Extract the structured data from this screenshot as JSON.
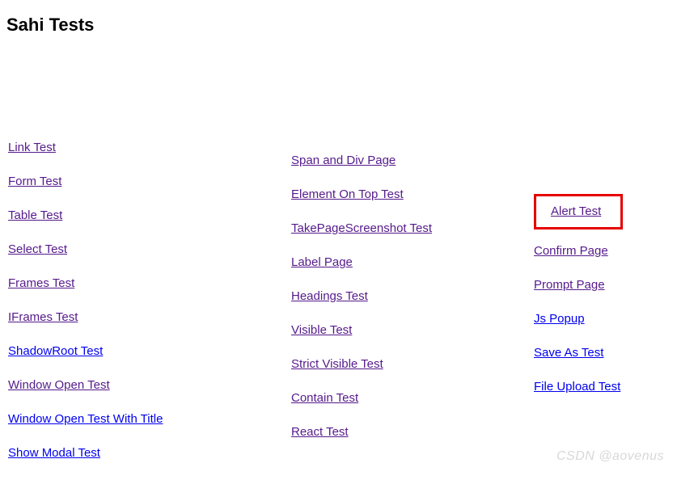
{
  "title": "Sahi Tests",
  "col1": [
    "Link Test",
    "Form Test",
    "Table Test",
    "Select Test",
    "Frames Test",
    "IFrames Test",
    "ShadowRoot Test",
    "Window Open Test",
    "Window Open Test With Title",
    "Show Modal Test"
  ],
  "col2": [
    "Span and Div Page",
    "Element On Top Test",
    "TakePageScreenshot Test",
    "Label Page",
    "Headings Test",
    "Visible Test",
    "Strict Visible Test",
    "Contain Test",
    "React Test"
  ],
  "col3": [
    "Alert Test",
    "Confirm Page",
    "Prompt Page",
    "Js Popup",
    "Save As Test",
    "File Upload Test"
  ],
  "col3_highlighted": "Alert Test",
  "watermark": "CSDN @aovenus"
}
